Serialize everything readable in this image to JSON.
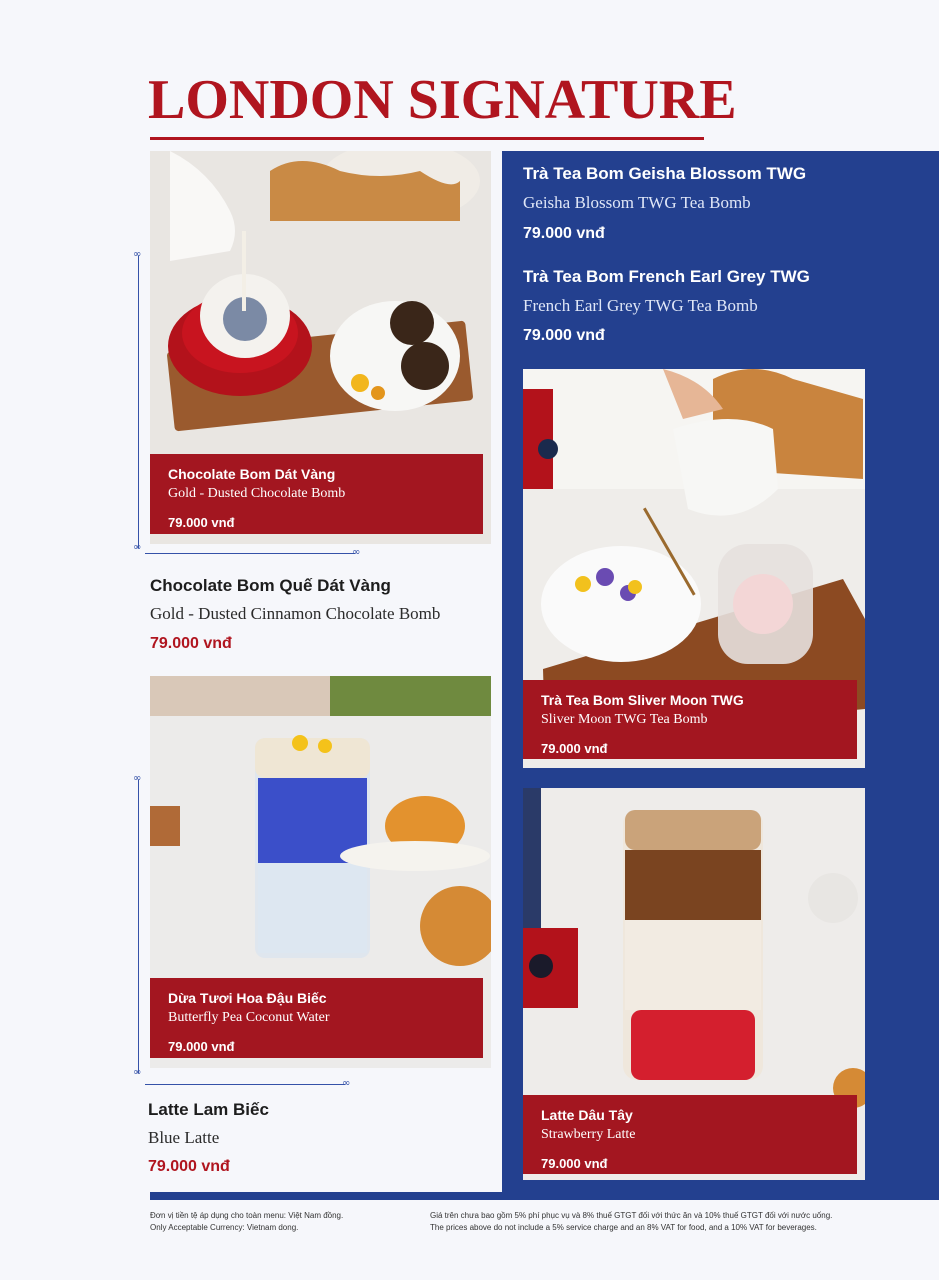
{
  "title": "LONDON SIGNATURE",
  "colors": {
    "accent_red": "#a31620",
    "panel_blue": "#23408f",
    "page_bg": "#f6f7fb"
  },
  "photo_cards": [
    {
      "name_vn": "Chocolate Bom Dát Vàng",
      "name_en": "Gold - Dusted Chocolate Bomb",
      "price": "79.000 vnđ"
    },
    {
      "name_vn": "Dừa Tươi Hoa Đậu Biếc",
      "name_en": "Butterfly Pea Coconut Water",
      "price": "79.000 vnđ"
    },
    {
      "name_vn": "Trà Tea Bom Sliver Moon TWG",
      "name_en": "Sliver Moon TWG Tea Bomb",
      "price": "79.000 vnđ"
    },
    {
      "name_vn": "Latte Dâu Tây",
      "name_en": "Strawberry Latte",
      "price": "79.000 vnđ"
    }
  ],
  "text_items": [
    {
      "name_vn": "Chocolate Bom Quế Dát Vàng",
      "name_en": "Gold - Dusted Cinnamon Chocolate Bomb",
      "price": "79.000 vnđ"
    },
    {
      "name_vn": "Latte Lam Biếc",
      "name_en": "Blue Latte",
      "price": "79.000 vnđ"
    },
    {
      "name_vn": "Trà Tea Bom Geisha Blossom TWG",
      "name_en": "Geisha Blossom TWG Tea Bomb",
      "price": "79.000 vnđ"
    },
    {
      "name_vn": "Trà Tea Bom French Earl Grey TWG",
      "name_en": "French Earl Grey TWG Tea Bomb",
      "price": "79.000 vnđ"
    }
  ],
  "footer": {
    "currency_vn": "Đơn vị tiền tệ áp dụng cho toàn menu: Việt Nam đồng.",
    "currency_en": "Only Acceptable Currency: Vietnam dong.",
    "tax_vn": "Giá trên chưa bao gồm 5% phí phục vụ và 8% thuế GTGT đối với thức ăn và 10% thuế GTGT đối với nước uống.",
    "tax_en": "The prices above do not include a 5% service charge and an 8% VAT for food, and a 10% VAT for beverages."
  }
}
